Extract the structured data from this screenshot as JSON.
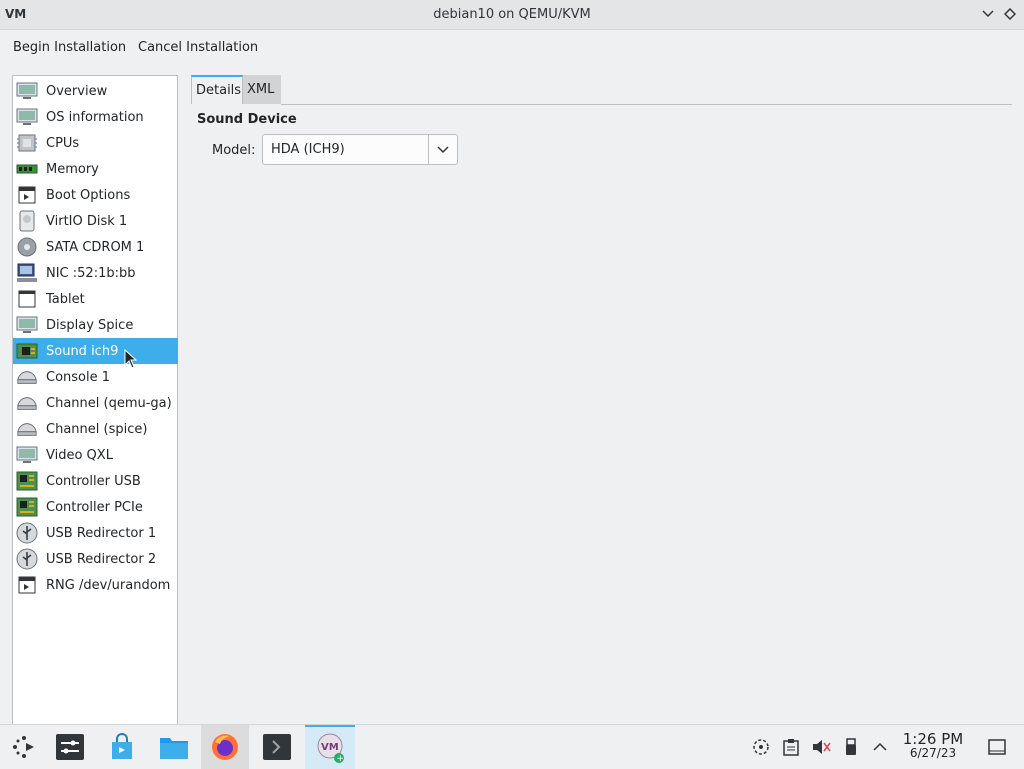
{
  "window": {
    "title": "debian10 on QEMU/KVM"
  },
  "menu": {
    "begin": "Begin Installation",
    "cancel": "Cancel Installation"
  },
  "devices": [
    {
      "label": "Overview",
      "icon": "monitor-icon"
    },
    {
      "label": "OS information",
      "icon": "monitor-icon"
    },
    {
      "label": "CPUs",
      "icon": "cpu-icon"
    },
    {
      "label": "Memory",
      "icon": "memory-icon"
    },
    {
      "label": "Boot Options",
      "icon": "boot-icon"
    },
    {
      "label": "VirtIO Disk 1",
      "icon": "disk-icon"
    },
    {
      "label": "SATA CDROM 1",
      "icon": "cdrom-icon"
    },
    {
      "label": "NIC :52:1b:bb",
      "icon": "network-icon"
    },
    {
      "label": "Tablet",
      "icon": "tablet-icon"
    },
    {
      "label": "Display Spice",
      "icon": "display-icon"
    },
    {
      "label": "Sound ich9",
      "icon": "sound-card-icon",
      "selected": true
    },
    {
      "label": "Console 1",
      "icon": "serial-icon"
    },
    {
      "label": "Channel (qemu-ga)",
      "icon": "serial-icon"
    },
    {
      "label": "Channel (spice)",
      "icon": "serial-icon"
    },
    {
      "label": "Video QXL",
      "icon": "display-icon"
    },
    {
      "label": "Controller USB",
      "icon": "controller-icon"
    },
    {
      "label": "Controller PCIe",
      "icon": "controller-icon"
    },
    {
      "label": "USB Redirector 1",
      "icon": "usb-icon"
    },
    {
      "label": "USB Redirector 2",
      "icon": "usb-icon"
    },
    {
      "label": "RNG /dev/urandom",
      "icon": "rng-icon"
    }
  ],
  "tabs": {
    "details": "Details",
    "xml": "XML"
  },
  "details": {
    "section_title": "Sound Device",
    "model_label": "Model:",
    "model_value": "HDA (ICH9)"
  },
  "clock": {
    "time": "1:26 PM",
    "date": "6/27/23"
  },
  "colors": {
    "accent": "#3daee9",
    "selected_text": "#ffffff",
    "background": "#eff0f1"
  }
}
